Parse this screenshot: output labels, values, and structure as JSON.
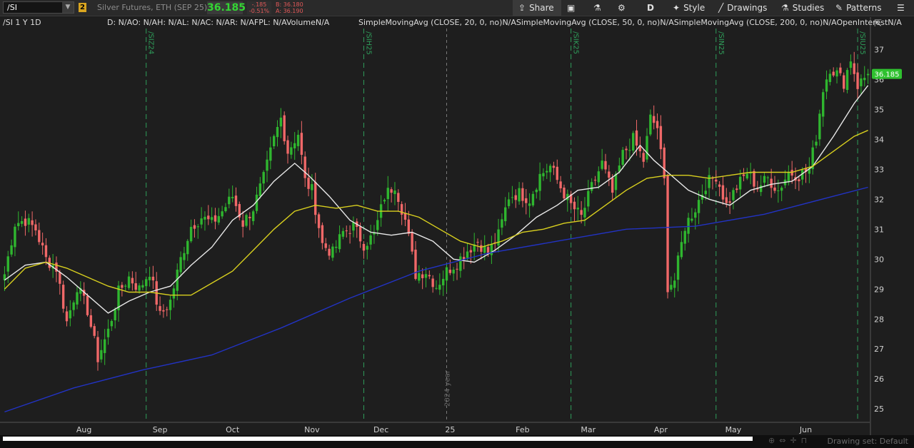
{
  "toolbar": {
    "symbol": "/SI",
    "symbol_dropdown_icon": "chevron-down-icon",
    "link_badge": "2",
    "description": "Silver Futures, ETH (SEP 25)",
    "last_price": "36.185",
    "net_change": "-.185",
    "pct_change": "-0.51%",
    "bid": "B: 36.180",
    "ask": "A: 36.190",
    "share_label": "Share",
    "aggregation_label": "D",
    "style_label": "Style",
    "drawings_label": "Drawings",
    "studies_label": "Studies",
    "patterns_label": "Patterns",
    "icons": [
      "share-icon",
      "compare-icon",
      "flask-icon",
      "gear-icon",
      "style-icon",
      "pencil-icon",
      "studies-icon",
      "patterns-icon",
      "menu-icon"
    ]
  },
  "header": {
    "period": "/SI 1 Y 1D",
    "ohlc": "D: N/AO: N/AH: N/AL: N/AC: N/AR: N/AFPL: N/AVolumeN/A",
    "studies": "SimpleMovingAvg (CLOSE, 20, 0, no)N/ASimpleMovingAvg (CLOSE, 50, 0, no)N/ASimpleMovingAvg (CLOSE, 200, 0, no)N/AOpenInterestN/A"
  },
  "footer": {
    "drawing_set": "Drawing set: Default",
    "icons": [
      "zoom-icon",
      "pan-icon",
      "crosshair-icon",
      "magnet-icon"
    ]
  },
  "colors": {
    "up": "#2fb62f",
    "down": "#f06868",
    "sma20": "#e8e8e8",
    "sma50": "#d8cf1e",
    "sma200": "#2233c4",
    "expiry": "#2f9e5a",
    "price_tag": "#2fc12f"
  },
  "chart_data": {
    "type": "candlestick",
    "ylim": [
      24.6,
      37.7
    ],
    "yticks": [
      25,
      26,
      27,
      28,
      29,
      30,
      31,
      32,
      33,
      34,
      35,
      36,
      37
    ],
    "x_labels": [
      {
        "label": "Aug",
        "idx": 23
      },
      {
        "label": "Sep",
        "idx": 45
      },
      {
        "label": "Oct",
        "idx": 66
      },
      {
        "label": "Nov",
        "idx": 89
      },
      {
        "label": "Dec",
        "idx": 109
      },
      {
        "label": "25",
        "idx": 129
      },
      {
        "label": "Feb",
        "idx": 150
      },
      {
        "label": "Mar",
        "idx": 169
      },
      {
        "label": "Apr",
        "idx": 190
      },
      {
        "label": "May",
        "idx": 211
      },
      {
        "label": "Jun",
        "idx": 232
      }
    ],
    "expiry_markers": [
      {
        "label": "/SIZ24",
        "idx": 41
      },
      {
        "label": "/SIH25",
        "idx": 104
      },
      {
        "label": "/SIK25",
        "idx": 164
      },
      {
        "label": "/SIN25",
        "idx": 206
      },
      {
        "label": "/SIU25",
        "idx": 247
      }
    ],
    "year_marker": {
      "label": "2024 year",
      "idx": 128
    },
    "last_price": 36.185,
    "last_price_label": "36.185",
    "bars": 251,
    "control_points": [
      [
        0,
        29.5
      ],
      [
        3,
        31.2
      ],
      [
        6,
        31.3
      ],
      [
        9,
        31.0
      ],
      [
        12,
        30.0
      ],
      [
        15,
        29.7
      ],
      [
        18,
        27.9
      ],
      [
        21,
        29.1
      ],
      [
        24,
        28.3
      ],
      [
        27,
        26.7
      ],
      [
        30,
        27.6
      ],
      [
        33,
        28.9
      ],
      [
        36,
        29.4
      ],
      [
        39,
        29.0
      ],
      [
        42,
        29.6
      ],
      [
        45,
        28.1
      ],
      [
        48,
        28.6
      ],
      [
        51,
        30.0
      ],
      [
        54,
        31.1
      ],
      [
        57,
        31.4
      ],
      [
        60,
        31.2
      ],
      [
        63,
        31.6
      ],
      [
        66,
        32.1
      ],
      [
        69,
        31.2
      ],
      [
        72,
        31.7
      ],
      [
        75,
        32.7
      ],
      [
        78,
        34.0
      ],
      [
        80,
        34.7
      ],
      [
        82,
        33.6
      ],
      [
        85,
        34.2
      ],
      [
        87,
        32.6
      ],
      [
        89,
        32.3
      ],
      [
        92,
        30.5
      ],
      [
        95,
        30.2
      ],
      [
        98,
        30.9
      ],
      [
        101,
        31.1
      ],
      [
        104,
        30.5
      ],
      [
        107,
        30.8
      ],
      [
        110,
        32.1
      ],
      [
        113,
        32.5
      ],
      [
        116,
        31.3
      ],
      [
        119,
        29.5
      ],
      [
        122,
        29.6
      ],
      [
        125,
        29.1
      ],
      [
        128,
        29.6
      ],
      [
        131,
        29.9
      ],
      [
        134,
        30.3
      ],
      [
        137,
        30.6
      ],
      [
        140,
        30.2
      ],
      [
        143,
        30.8
      ],
      [
        146,
        32.1
      ],
      [
        149,
        32.2
      ],
      [
        152,
        32.0
      ],
      [
        155,
        32.8
      ],
      [
        158,
        33.1
      ],
      [
        161,
        32.4
      ],
      [
        164,
        31.8
      ],
      [
        167,
        31.4
      ],
      [
        170,
        32.4
      ],
      [
        173,
        33.2
      ],
      [
        176,
        32.2
      ],
      [
        179,
        33.5
      ],
      [
        182,
        34.0
      ],
      [
        185,
        33.3
      ],
      [
        187,
        34.7
      ],
      [
        189,
        34.4
      ],
      [
        191,
        32.6
      ],
      [
        192,
        29.1
      ],
      [
        194,
        29.3
      ],
      [
        197,
        31.1
      ],
      [
        200,
        31.7
      ],
      [
        203,
        32.5
      ],
      [
        206,
        32.8
      ],
      [
        209,
        31.8
      ],
      [
        212,
        32.4
      ],
      [
        215,
        32.9
      ],
      [
        218,
        32.4
      ],
      [
        221,
        32.7
      ],
      [
        224,
        32.3
      ],
      [
        227,
        32.9
      ],
      [
        230,
        32.8
      ],
      [
        233,
        33.0
      ],
      [
        235,
        34.1
      ],
      [
        237,
        35.7
      ],
      [
        239,
        36.4
      ],
      [
        241,
        36.2
      ],
      [
        243,
        35.9
      ],
      [
        245,
        36.7
      ],
      [
        247,
        35.8
      ],
      [
        250,
        36.185
      ]
    ],
    "sma_series": [
      {
        "period": 20,
        "points": [
          [
            0,
            29.3
          ],
          [
            6,
            29.8
          ],
          [
            12,
            29.9
          ],
          [
            18,
            29.4
          ],
          [
            24,
            28.8
          ],
          [
            30,
            28.2
          ],
          [
            36,
            28.6
          ],
          [
            42,
            28.9
          ],
          [
            48,
            29.1
          ],
          [
            54,
            29.8
          ],
          [
            60,
            30.4
          ],
          [
            66,
            31.3
          ],
          [
            72,
            31.8
          ],
          [
            78,
            32.6
          ],
          [
            84,
            33.2
          ],
          [
            88,
            32.8
          ],
          [
            94,
            32.1
          ],
          [
            100,
            31.3
          ],
          [
            106,
            30.9
          ],
          [
            112,
            30.8
          ],
          [
            118,
            30.9
          ],
          [
            124,
            30.6
          ],
          [
            130,
            30.0
          ],
          [
            136,
            29.9
          ],
          [
            142,
            30.3
          ],
          [
            148,
            30.8
          ],
          [
            154,
            31.4
          ],
          [
            160,
            31.8
          ],
          [
            166,
            32.3
          ],
          [
            172,
            32.4
          ],
          [
            178,
            32.9
          ],
          [
            184,
            33.8
          ],
          [
            188,
            33.3
          ],
          [
            192,
            32.9
          ],
          [
            198,
            32.3
          ],
          [
            204,
            32.0
          ],
          [
            210,
            31.8
          ],
          [
            216,
            32.3
          ],
          [
            222,
            32.5
          ],
          [
            228,
            32.6
          ],
          [
            234,
            33.1
          ],
          [
            240,
            34.1
          ],
          [
            246,
            35.2
          ],
          [
            250,
            35.8
          ]
        ]
      },
      {
        "period": 50,
        "points": [
          [
            0,
            29.0
          ],
          [
            6,
            29.7
          ],
          [
            12,
            29.9
          ],
          [
            18,
            29.7
          ],
          [
            24,
            29.4
          ],
          [
            30,
            29.1
          ],
          [
            36,
            28.9
          ],
          [
            42,
            28.9
          ],
          [
            48,
            28.8
          ],
          [
            54,
            28.8
          ],
          [
            60,
            29.2
          ],
          [
            66,
            29.6
          ],
          [
            72,
            30.3
          ],
          [
            78,
            31.0
          ],
          [
            84,
            31.6
          ],
          [
            90,
            31.8
          ],
          [
            96,
            31.7
          ],
          [
            102,
            31.8
          ],
          [
            108,
            31.6
          ],
          [
            114,
            31.6
          ],
          [
            120,
            31.4
          ],
          [
            126,
            31.0
          ],
          [
            132,
            30.6
          ],
          [
            138,
            30.4
          ],
          [
            144,
            30.6
          ],
          [
            150,
            30.9
          ],
          [
            156,
            31.0
          ],
          [
            162,
            31.2
          ],
          [
            168,
            31.3
          ],
          [
            174,
            31.8
          ],
          [
            180,
            32.3
          ],
          [
            186,
            32.7
          ],
          [
            192,
            32.8
          ],
          [
            198,
            32.8
          ],
          [
            204,
            32.7
          ],
          [
            210,
            32.8
          ],
          [
            216,
            32.9
          ],
          [
            222,
            32.9
          ],
          [
            228,
            32.9
          ],
          [
            234,
            33.1
          ],
          [
            240,
            33.6
          ],
          [
            246,
            34.1
          ],
          [
            250,
            34.3
          ]
        ]
      },
      {
        "period": 200,
        "points": [
          [
            0,
            24.9
          ],
          [
            20,
            25.7
          ],
          [
            40,
            26.3
          ],
          [
            60,
            26.8
          ],
          [
            80,
            27.7
          ],
          [
            100,
            28.7
          ],
          [
            120,
            29.6
          ],
          [
            140,
            30.2
          ],
          [
            160,
            30.6
          ],
          [
            180,
            31.0
          ],
          [
            200,
            31.1
          ],
          [
            220,
            31.5
          ],
          [
            240,
            32.1
          ],
          [
            250,
            32.4
          ]
        ]
      }
    ]
  }
}
